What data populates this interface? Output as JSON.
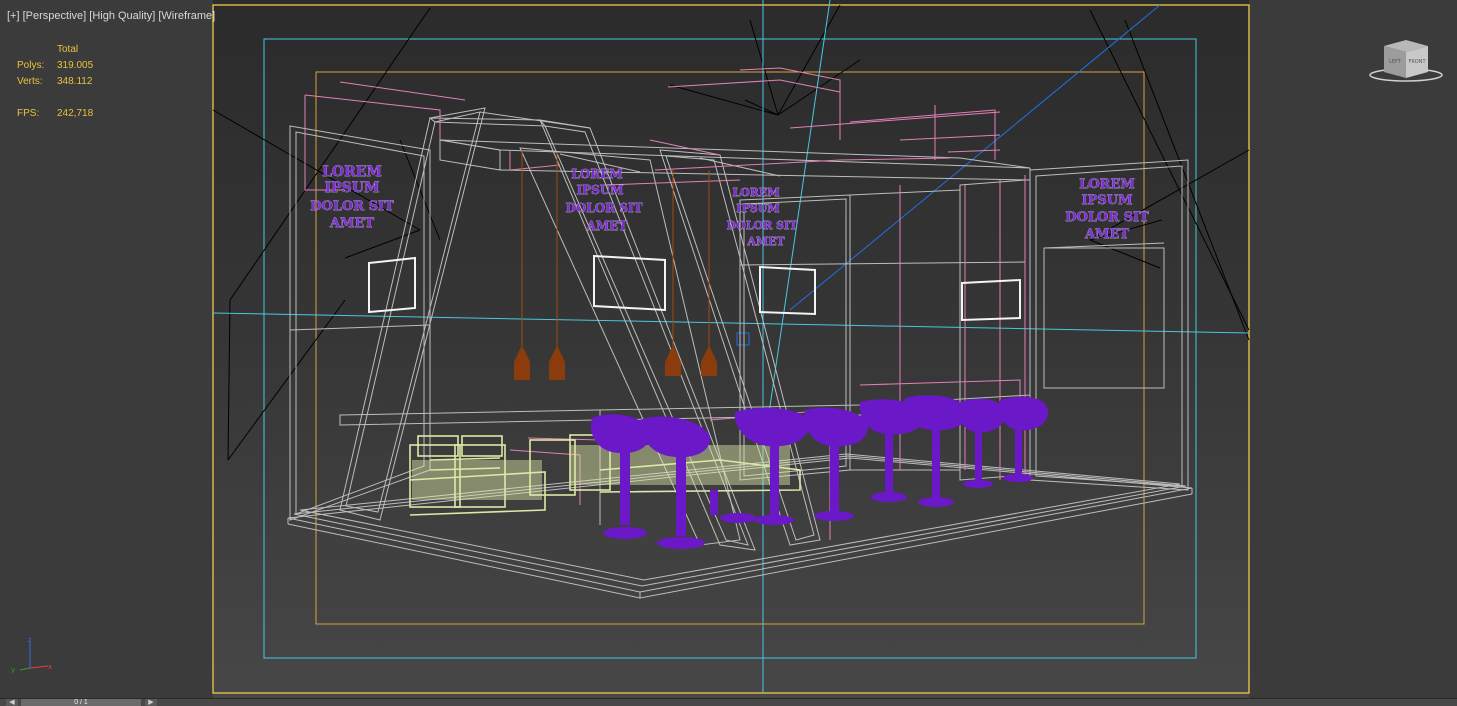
{
  "viewport": {
    "label_parts": [
      "[+]",
      "[Perspective]",
      "[High Quality]",
      "[Wireframe]"
    ]
  },
  "stats": {
    "header": "Total",
    "polys_label": "Polys:",
    "polys_value": "319.005",
    "verts_label": "Verts:",
    "verts_value": "348.112",
    "fps_label": "FPS:",
    "fps_value": "242,718"
  },
  "scene": {
    "sign_text": [
      "LOREM",
      "IPSUM",
      "DOLOR SIT",
      "AMET"
    ]
  },
  "viewcube": {
    "left_face": "LEFT",
    "front_face": "FRONT"
  },
  "axis_tripod": {
    "x": "x",
    "y": "y",
    "z": "z"
  },
  "timeline": {
    "position": "0 / 1",
    "prev_icon": "chevron-left-icon",
    "next_icon": "chevron-right-icon"
  },
  "colors": {
    "safe_frame_outer": "#e0c048",
    "safe_frame_action": "#48c8e0",
    "safe_frame_title": "#d8a040",
    "wire_gray": "#bdbdbd",
    "wire_pink": "#e080b8",
    "sofa": "#dfe8a6",
    "stools": "#6a18c8",
    "lamps": "#8a3c0c",
    "stats_text": "#e8c23c"
  }
}
